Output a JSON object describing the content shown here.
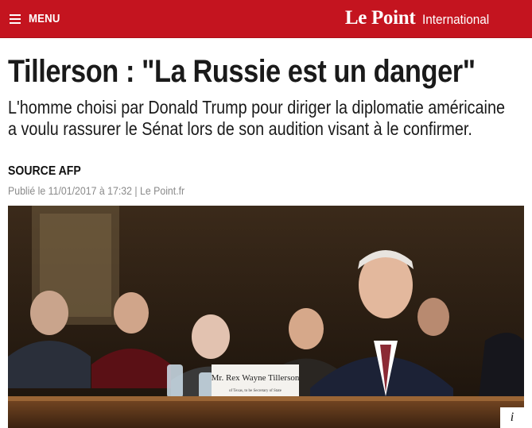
{
  "header": {
    "menu_label": "MENU",
    "logo": "Le Point",
    "section": "International",
    "bar_color": "#c4141f"
  },
  "article": {
    "title": "Tillerson : \"La Russie est un danger\"",
    "lede": "L'homme choisi par Donald Trump pour diriger la diplomatie américaine a voulu rassurer le Sénat lors de son audition visant à le confirmer.",
    "source": "SOURCE AFP",
    "published": "Publié le 11/01/2017 à 17:32 | Le Point.fr"
  },
  "photo": {
    "nameplate_line1": "Mr. Rex Wayne Tillerson",
    "nameplate_line2": "of Texas, to be Secretary of State",
    "info_icon": "info-icon",
    "info_glyph": "i"
  }
}
